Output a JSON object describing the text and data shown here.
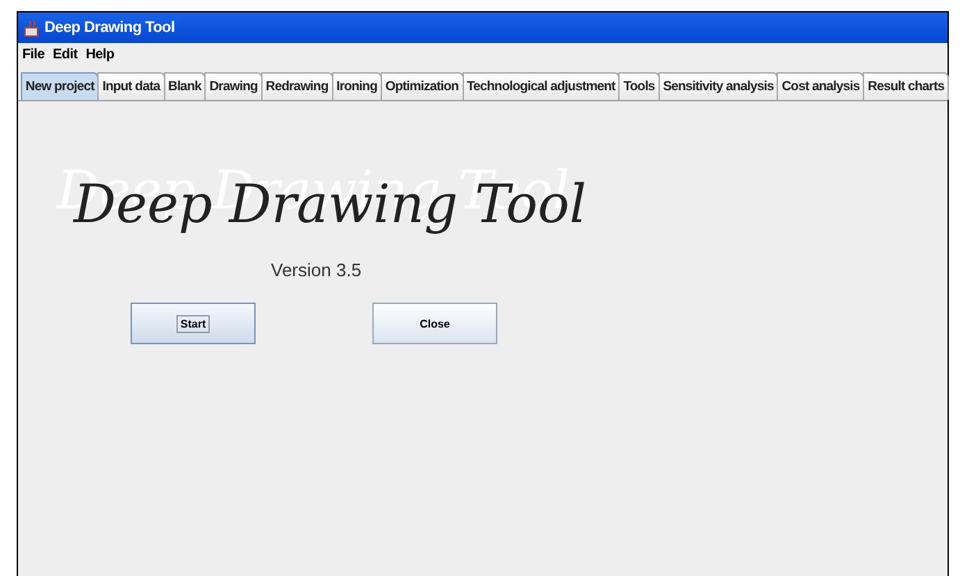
{
  "window": {
    "title": "Deep Drawing Tool"
  },
  "menu": [
    "File",
    "Edit",
    "Help"
  ],
  "tabs": [
    {
      "label": "New project",
      "selected": true
    },
    {
      "label": "Input data",
      "selected": false
    },
    {
      "label": "Blank",
      "selected": false
    },
    {
      "label": "Drawing",
      "selected": false
    },
    {
      "label": "Redrawing",
      "selected": false
    },
    {
      "label": "Ironing",
      "selected": false
    },
    {
      "label": "Optimization",
      "selected": false
    },
    {
      "label": "Technological adjustment",
      "selected": false
    },
    {
      "label": "Tools",
      "selected": false
    },
    {
      "label": "Sensitivity analysis",
      "selected": false
    },
    {
      "label": "Cost analysis",
      "selected": false
    },
    {
      "label": "Result charts",
      "selected": false
    }
  ],
  "splash": {
    "logo": "Deep Drawing Tool",
    "version": "Version 3.5"
  },
  "buttons": [
    {
      "label": "Start",
      "focused": true
    },
    {
      "label": "Close",
      "focused": false
    }
  ]
}
